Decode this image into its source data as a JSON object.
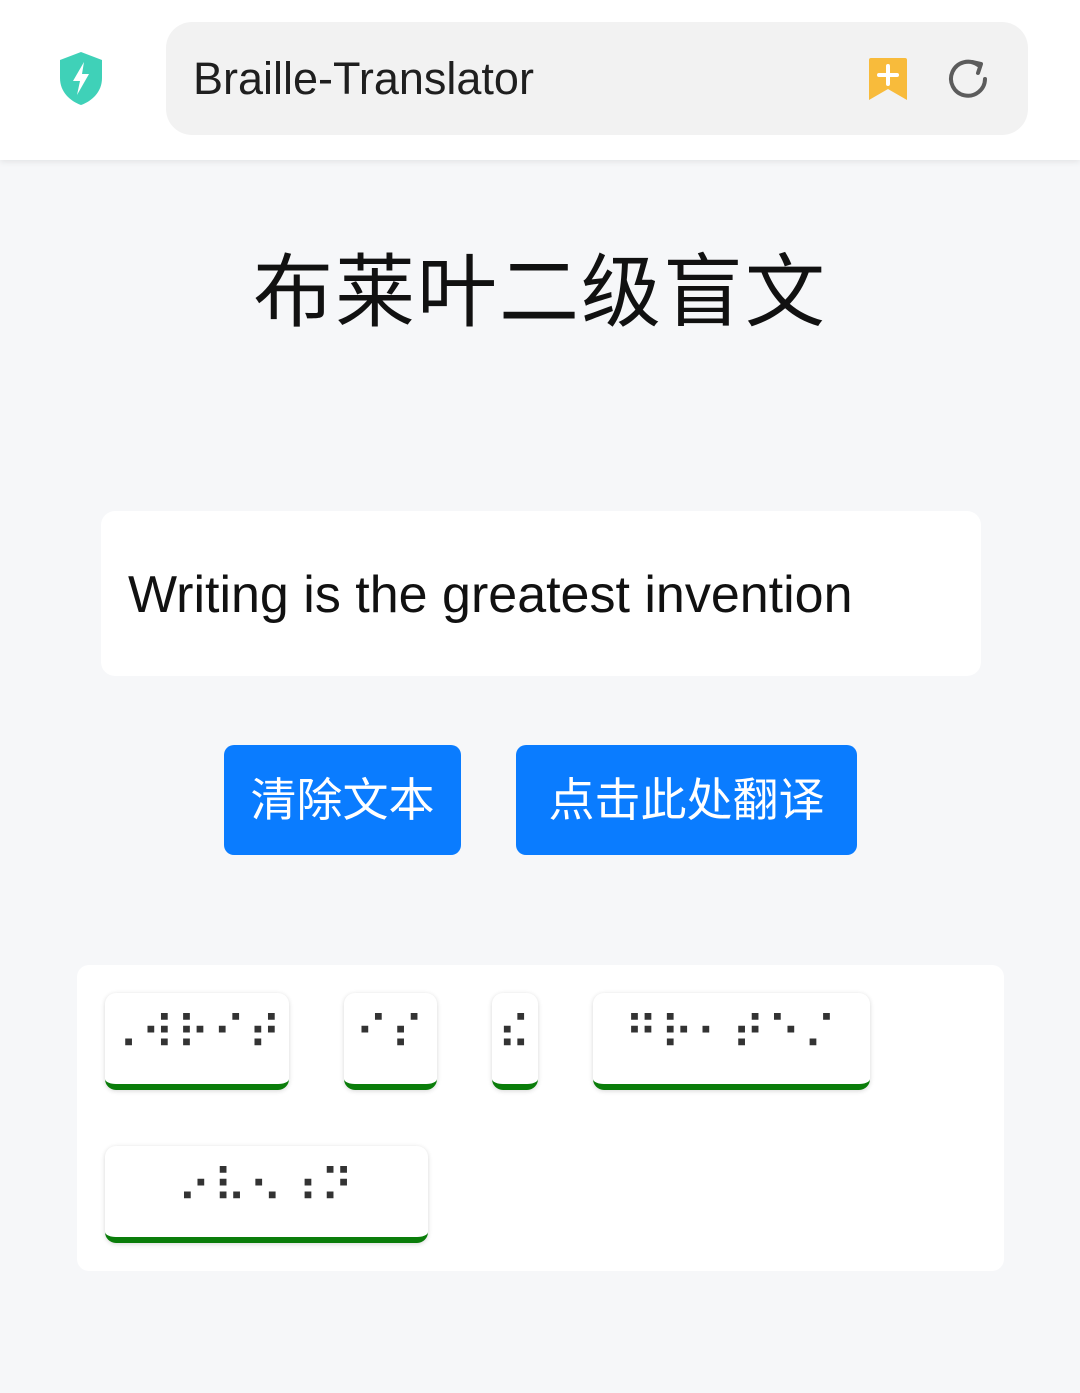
{
  "header": {
    "url_title": "Braille-Translator",
    "security_icon": "shield-bolt-icon",
    "bookmark_icon": "bookmark-add-icon",
    "refresh_icon": "refresh-icon",
    "accent_color": "#3fd1b8",
    "bookmark_color": "#f8bb3b"
  },
  "main": {
    "title": "布莱叶二级盲文",
    "input_value": "Writing is the greatest invention",
    "clear_label": "清除文本",
    "translate_label": "点击此处翻译",
    "button_color": "#0a7cff"
  },
  "output": {
    "underline_color": "#0a7d0a",
    "words": [
      {
        "braille": "⠠⠺⠗⠊⠞⠬"
      },
      {
        "braille": "⠊⠎"
      },
      {
        "braille": "⠮"
      },
      {
        "braille": "⠛⠗⠂⠞⠑⠌"
      },
      {
        "braille": "⠔⠧⠢⠰⠝"
      }
    ]
  }
}
